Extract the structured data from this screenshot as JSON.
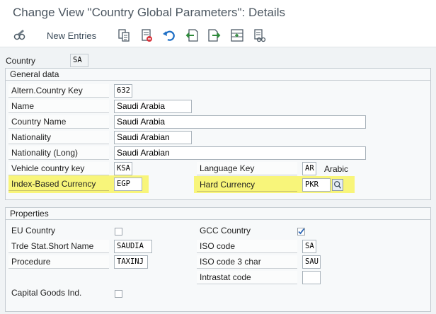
{
  "window": {
    "title": "Change View \"Country Global Parameters\": Details"
  },
  "toolbar": {
    "new_entries_label": "New Entries"
  },
  "header": {
    "country_label": "Country",
    "country_value": "SA"
  },
  "general": {
    "title": "General data",
    "altern_country_key_label": "Altern.Country Key",
    "altern_country_key_value": "632",
    "name_label": "Name",
    "name_value": "Saudi Arabia",
    "country_name_label": "Country Name",
    "country_name_value": "Saudi Arabia",
    "nationality_label": "Nationality",
    "nationality_value": "Saudi Arabian",
    "nationality_long_label": "Nationality (Long)",
    "nationality_long_value": "Saudi Arabian",
    "vehicle_country_key_label": "Vehicle country key",
    "vehicle_country_key_value": "KSA",
    "language_key_label": "Language Key",
    "language_key_value": "AR",
    "language_name": "Arabic",
    "index_based_currency_label": "Index-Based Currency",
    "index_based_currency_value": "EGP",
    "hard_currency_label": "Hard Currency",
    "hard_currency_value": "PKR"
  },
  "properties": {
    "title": "Properties",
    "eu_country_label": "EU Country",
    "eu_country_checked": false,
    "gcc_country_label": "GCC Country",
    "gcc_country_checked": true,
    "trde_stat_short_name_label": "Trde Stat.Short Name",
    "trde_stat_short_name_value": "SAUDIA",
    "iso_code_label": "ISO code",
    "iso_code_value": "SA",
    "procedure_label": "Procedure",
    "procedure_value": "TAXINJ",
    "iso_code_3_char_label": "ISO code 3 char",
    "iso_code_3_char_value": "SAU",
    "intrastat_code_label": "Intrastat code",
    "intrastat_code_value": "",
    "capital_goods_ind_label": "Capital Goods Ind.",
    "capital_goods_ind_checked": false
  },
  "colors": {
    "highlight": "#f8f57a",
    "title_text": "#4b5660",
    "check_blue": "#2a64b4"
  }
}
